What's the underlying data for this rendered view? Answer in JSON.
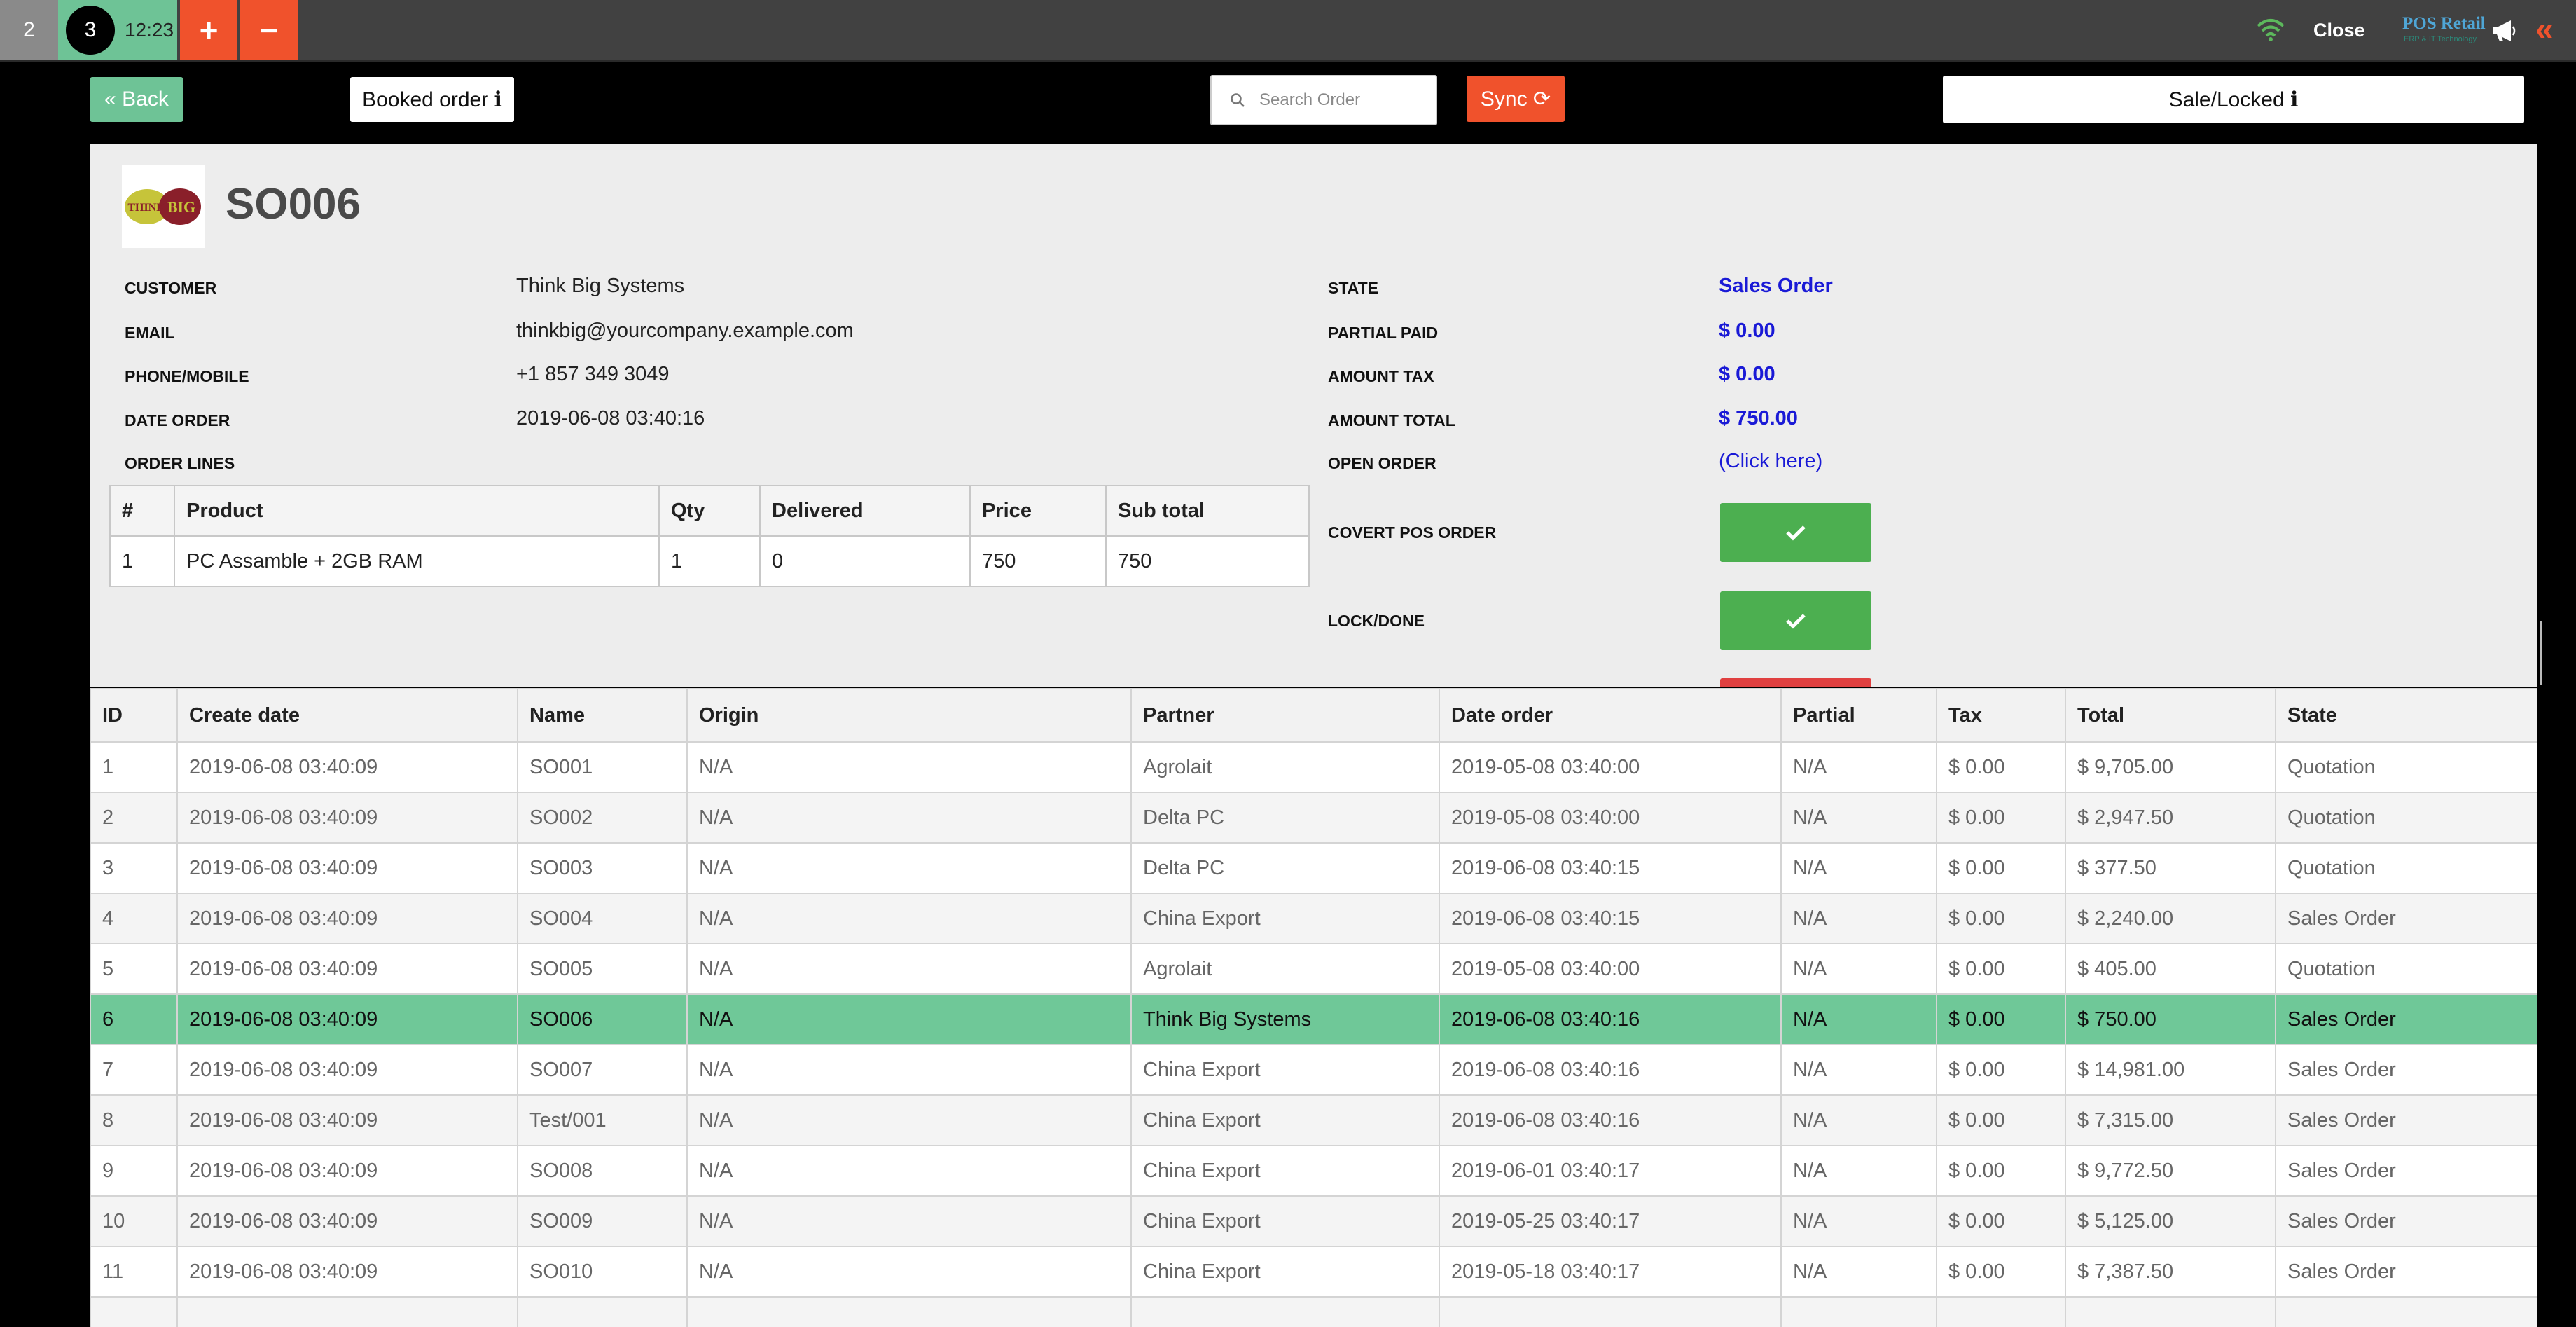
{
  "topbar": {
    "order_tabs": [
      {
        "label": "2"
      },
      {
        "label": "3",
        "time": "12:23"
      }
    ],
    "add_label": "+",
    "remove_label": "−",
    "close_label": "Close",
    "logo_text": "POS Retail",
    "logo_sub": "ERP & IT Technology"
  },
  "subheader": {
    "back_label": "« Back",
    "booked_label": "Booked order ℹ",
    "search_placeholder": "Search Order",
    "sync_label": "Sync ⟳",
    "sale_label": "Sale/Locked ℹ"
  },
  "detail": {
    "logo_text": "THINK BIG",
    "order_name": "SO006",
    "left_fields": [
      {
        "label": "CUSTOMER",
        "value": "Think Big Systems"
      },
      {
        "label": "EMAIL",
        "value": "thinkbig@yourcompany.example.com"
      },
      {
        "label": "PHONE/MOBILE",
        "value": "+1 857 349 3049"
      },
      {
        "label": "DATE ORDER",
        "value": "2019-06-08 03:40:16"
      }
    ],
    "order_lines_label": "ORDER LINES",
    "lines_headers": [
      "#",
      "Product",
      "Qty",
      "Delivered",
      "Price",
      "Sub total"
    ],
    "lines": [
      [
        "1",
        "PC Assamble + 2GB RAM",
        "1",
        "0",
        "750",
        "750"
      ]
    ],
    "right_fields": [
      {
        "label": "STATE",
        "value": "Sales Order"
      },
      {
        "label": "PARTIAL PAID",
        "value": "$ 0.00"
      },
      {
        "label": "AMOUNT TAX",
        "value": "$ 0.00"
      },
      {
        "label": "AMOUNT TOTAL",
        "value": "$ 750.00"
      }
    ],
    "open_order_label": "OPEN ORDER",
    "open_order_link": "(Click here)",
    "covert_label": "COVERT POS ORDER",
    "lock_label": "LOCK/DONE",
    "accent_green": "#4caf50",
    "accent_red": "#e04040"
  },
  "orders": {
    "headers": [
      "ID",
      "Create date",
      "Name",
      "Origin",
      "Partner",
      "Date order",
      "Partial",
      "Tax",
      "Total",
      "State"
    ],
    "rows": [
      [
        "1",
        "2019-06-08 03:40:09",
        "SO001",
        "N/A",
        "Agrolait",
        "2019-05-08 03:40:00",
        "N/A",
        "$ 0.00",
        "$ 9,705.00",
        "Quotation"
      ],
      [
        "2",
        "2019-06-08 03:40:09",
        "SO002",
        "N/A",
        "Delta PC",
        "2019-05-08 03:40:00",
        "N/A",
        "$ 0.00",
        "$ 2,947.50",
        "Quotation"
      ],
      [
        "3",
        "2019-06-08 03:40:09",
        "SO003",
        "N/A",
        "Delta PC",
        "2019-06-08 03:40:15",
        "N/A",
        "$ 0.00",
        "$ 377.50",
        "Quotation"
      ],
      [
        "4",
        "2019-06-08 03:40:09",
        "SO004",
        "N/A",
        "China Export",
        "2019-06-08 03:40:15",
        "N/A",
        "$ 0.00",
        "$ 2,240.00",
        "Sales Order"
      ],
      [
        "5",
        "2019-06-08 03:40:09",
        "SO005",
        "N/A",
        "Agrolait",
        "2019-05-08 03:40:00",
        "N/A",
        "$ 0.00",
        "$ 405.00",
        "Quotation"
      ],
      [
        "6",
        "2019-06-08 03:40:09",
        "SO006",
        "N/A",
        "Think Big Systems",
        "2019-06-08 03:40:16",
        "N/A",
        "$ 0.00",
        "$ 750.00",
        "Sales Order"
      ],
      [
        "7",
        "2019-06-08 03:40:09",
        "SO007",
        "N/A",
        "China Export",
        "2019-06-08 03:40:16",
        "N/A",
        "$ 0.00",
        "$ 14,981.00",
        "Sales Order"
      ],
      [
        "8",
        "2019-06-08 03:40:09",
        "Test/001",
        "N/A",
        "China Export",
        "2019-06-08 03:40:16",
        "N/A",
        "$ 0.00",
        "$ 7,315.00",
        "Sales Order"
      ],
      [
        "9",
        "2019-06-08 03:40:09",
        "SO008",
        "N/A",
        "China Export",
        "2019-06-01 03:40:17",
        "N/A",
        "$ 0.00",
        "$ 9,772.50",
        "Sales Order"
      ],
      [
        "10",
        "2019-06-08 03:40:09",
        "SO009",
        "N/A",
        "China Export",
        "2019-05-25 03:40:17",
        "N/A",
        "$ 0.00",
        "$ 5,125.00",
        "Sales Order"
      ],
      [
        "11",
        "2019-06-08 03:40:09",
        "SO010",
        "N/A",
        "China Export",
        "2019-05-18 03:40:17",
        "N/A",
        "$ 0.00",
        "$ 7,387.50",
        "Sales Order"
      ],
      [
        "",
        "",
        "",
        "",
        "",
        "",
        "",
        "",
        "",
        ""
      ]
    ],
    "selected_row_id": "6",
    "highlight_color": "#6fc898"
  }
}
